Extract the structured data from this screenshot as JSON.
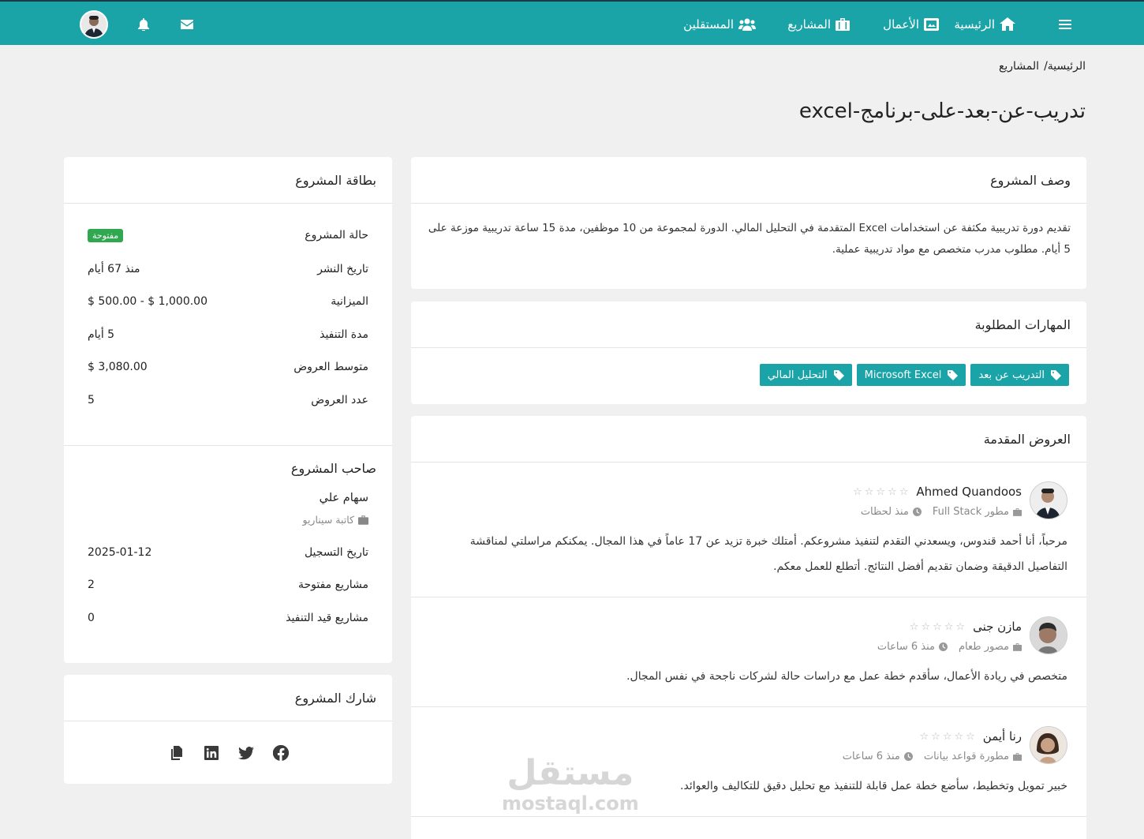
{
  "nav": {
    "home": "الرئيسية",
    "works": "الأعمال",
    "projects": "المشاريع",
    "freelancers": "المستقلين"
  },
  "breadcrumb": {
    "home": "الرئيسية/",
    "current": "المشاريع"
  },
  "page_title": "تدريب-عن-بعد-على-برنامج-excel",
  "description": {
    "heading": "وصف المشروع",
    "text": "تقديم دورة تدريبية مكثفة عن استخدامات Excel المتقدمة في التحليل المالي. الدورة لمجموعة من 10 موظفين، مدة 15 ساعة تدريبية موزعة على 5 أيام. مطلوب مدرب متخصص مع مواد تدريبية عملية."
  },
  "skills": {
    "heading": "المهارات المطلوبة",
    "items": [
      "التدريب عن بعد",
      "Microsoft Excel",
      "التحليل المالي"
    ]
  },
  "bids": {
    "heading": "العروض المقدمة",
    "items": [
      {
        "name": "Ahmed Quandoos",
        "role": "مطور Full Stack",
        "time": "منذ لحظات",
        "rating": 0,
        "text": "مرحباً، أنا أحمد قندوس، ويسعدني التقدم لتنفيذ مشروعكم. أمتلك خبرة تزيد عن 17 عاماً في هذا المجال. يمكنكم مراسلتي لمناقشة التفاصيل الدقيقة وضمان تقديم أفضل النتائج. أتطلع للعمل معكم."
      },
      {
        "name": "مازن جنى",
        "role": "مصور طعام",
        "time": "منذ 6 ساعات",
        "rating": 0,
        "text": "متخصص في ريادة الأعمال، سأقدم خطة عمل مع دراسات حالة لشركات ناجحة في نفس المجال."
      },
      {
        "name": "رنا أيمن",
        "role": "مطورة قواعد بيانات",
        "time": "منذ 6 ساعات",
        "rating": 0,
        "text": "خبير تمويل وتخطيط، سأضع خطة عمل قابلة للتنفيذ مع تحليل دقيق للتكاليف والعوائد."
      }
    ]
  },
  "project_card": {
    "heading": "بطاقة المشروع",
    "status_label": "حالة المشروع",
    "status_value": "مفتوحة",
    "status_color": "#2fa84f",
    "published_label": "تاريخ النشر",
    "published_value": "منذ 67 أيام",
    "budget_label": "الميزانية",
    "budget_value": "$ 500.00 - $ 1,000.00",
    "duration_label": "مدة التنفيذ",
    "duration_value": "5 أيام",
    "avg_bids_label": "متوسط العروض",
    "avg_bids_value": "$ 3,080.00",
    "bids_count_label": "عدد العروض",
    "bids_count_value": "5"
  },
  "owner": {
    "heading": "صاحب المشروع",
    "name": "سهام علي",
    "role": "كاتبة سيناريو",
    "registered_label": "تاريخ التسجيل",
    "registered_value": "2025-01-12",
    "open_label": "مشاريع مفتوحة",
    "open_value": "2",
    "in_progress_label": "مشاريع قيد التنفيذ",
    "in_progress_value": "0"
  },
  "share": {
    "heading": "شارك المشروع",
    "icons": [
      "facebook-icon",
      "twitter-icon",
      "linkedin-icon",
      "copy-icon"
    ]
  },
  "watermark": {
    "ar": "مستقل",
    "en": "mostaql.com"
  },
  "colors": {
    "brand": "#1aa4a8",
    "page_bg": "#f0f0f0",
    "badge": "#2fa84f"
  }
}
